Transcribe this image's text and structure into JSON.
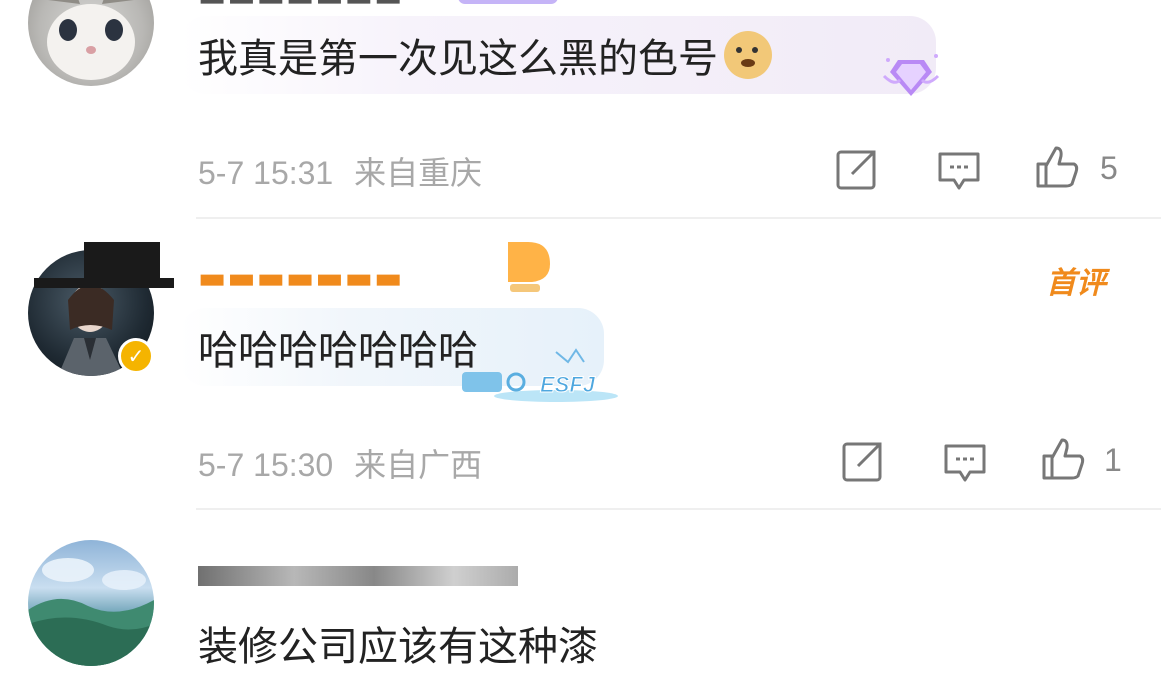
{
  "comments": [
    {
      "text": "我真是第一次见这么黑的色号",
      "time": "5-7 15:31",
      "location": "来自重庆",
      "likes": "5",
      "emoji": "doge-emoji",
      "decoration": "purple-gem-icon"
    },
    {
      "text": "哈哈哈哈哈哈哈",
      "time": "5-7 15:30",
      "location": "来自广西",
      "likes": "1",
      "tag": "首评",
      "decoration": "ESFJ"
    },
    {
      "text": "装修公司应该有这种漆"
    }
  ],
  "colors": {
    "accent_orange": "#f08a1c",
    "meta_gray": "#a8a8a8",
    "verified_gold": "#f5b400"
  },
  "icons": {
    "share": "share-icon",
    "comment": "comment-icon",
    "like": "like-icon"
  }
}
